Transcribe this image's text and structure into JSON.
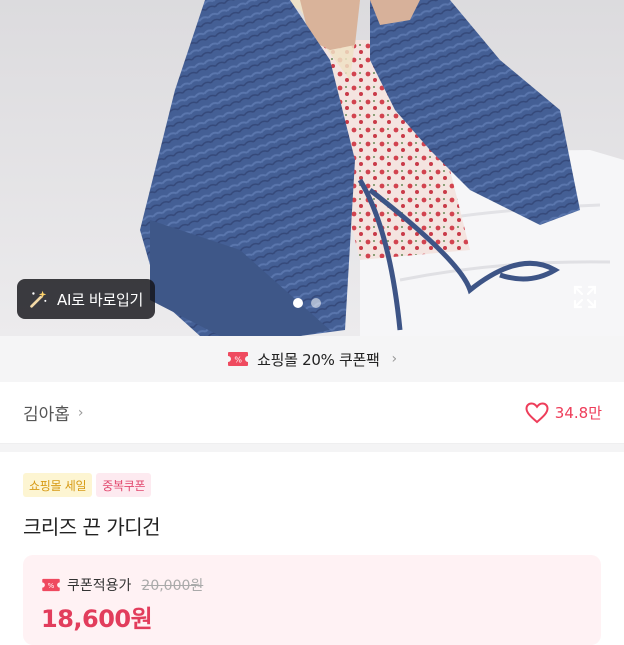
{
  "hero": {
    "ai_button_label": "AI로 바로입기",
    "slide_count": 2,
    "active_slide": 1
  },
  "coupon_banner": {
    "text": "쇼핑몰 20% 쿠폰팩"
  },
  "seller": {
    "name": "김아홉"
  },
  "likes": {
    "count": "34.8만"
  },
  "badges": {
    "sale": "쇼핑몰 세일",
    "duplicate_coupon": "중복쿠폰"
  },
  "product": {
    "title": "크리즈 끈 가디건"
  },
  "price": {
    "coupon_label": "쿠폰적용가",
    "original": "20,000원",
    "final": "18,600원"
  },
  "colors": {
    "accent": "#e23d5c",
    "heart": "#ee3d5a",
    "sale_badge": "#d79b17"
  }
}
